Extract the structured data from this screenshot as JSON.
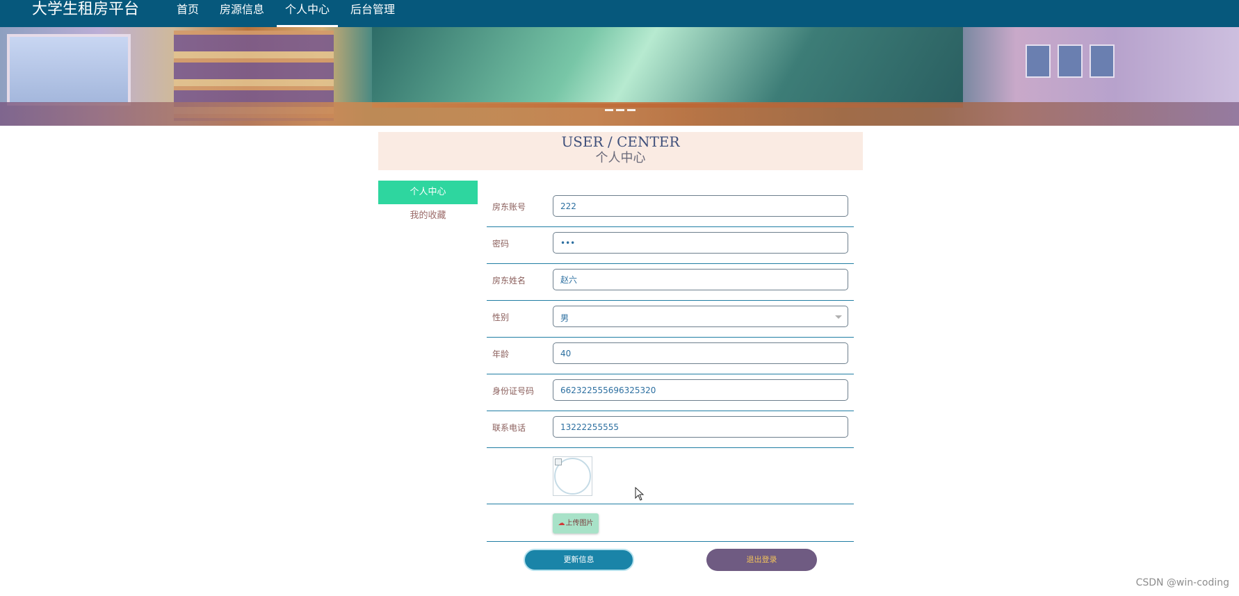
{
  "nav": {
    "brand": "大学生租房平台",
    "links": [
      {
        "label": "首页",
        "active": false
      },
      {
        "label": "房源信息",
        "active": false
      },
      {
        "label": "个人中心",
        "active": true
      },
      {
        "label": "后台管理",
        "active": false
      }
    ]
  },
  "header": {
    "title_en": "USER / CENTER",
    "title_cn": "个人中心"
  },
  "sidebar": {
    "items": [
      {
        "label": "个人中心",
        "active": true
      },
      {
        "label": "我的收藏",
        "active": false
      }
    ]
  },
  "form": {
    "account": {
      "label": "房东账号",
      "value": "222"
    },
    "password": {
      "label": "密码",
      "value": "•••"
    },
    "name": {
      "label": "房东姓名",
      "value": "赵六"
    },
    "gender": {
      "label": "性别",
      "value": "男"
    },
    "age": {
      "label": "年龄",
      "value": "40"
    },
    "id_number": {
      "label": "身份证号码",
      "value": "662322555696325320"
    },
    "phone": {
      "label": "联系电话",
      "value": "13222255555"
    },
    "upload_label": "上传图片"
  },
  "actions": {
    "update_label": "更新信息",
    "logout_label": "退出登录"
  },
  "colors": {
    "nav_bg": "#06587c",
    "sidebar_active": "#2ed69f",
    "update_button": "#1a84a8",
    "logout_button": "#6f5b82"
  },
  "watermark": "CSDN @win-coding"
}
